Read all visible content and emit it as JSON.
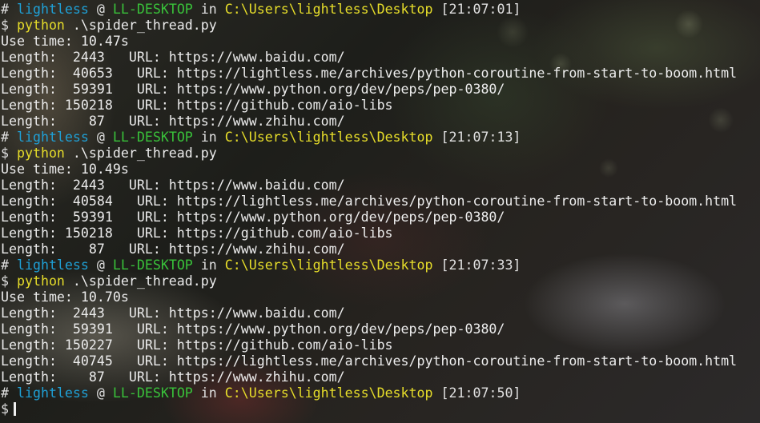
{
  "prompt_sep": " @ ",
  "prompt_in": " in ",
  "sessions": [
    {
      "user": "lightless",
      "host": "LL-DESKTOP",
      "path": "C:\\Users\\lightless\\Desktop",
      "time": "[21:07:01]",
      "command_bin": "python",
      "command_args": " .\\spider_thread.py",
      "use_time": "Use time: 10.47s",
      "results": [
        {
          "length": "Length:  2443",
          "url": "URL: https://www.baidu.com/"
        },
        {
          "length": "Length:  40653",
          "url": "URL: https://lightless.me/archives/python-coroutine-from-start-to-boom.html"
        },
        {
          "length": "Length:  59391",
          "url": "URL: https://www.python.org/dev/peps/pep-0380/"
        },
        {
          "length": "Length: 150218",
          "url": "URL: https://github.com/aio-libs"
        },
        {
          "length": "Length:    87",
          "url": "URL: https://www.zhihu.com/"
        }
      ]
    },
    {
      "user": "lightless",
      "host": "LL-DESKTOP",
      "path": "C:\\Users\\lightless\\Desktop",
      "time": "[21:07:13]",
      "command_bin": "python",
      "command_args": " .\\spider_thread.py",
      "use_time": "Use time: 10.49s",
      "results": [
        {
          "length": "Length:  2443",
          "url": "URL: https://www.baidu.com/"
        },
        {
          "length": "Length:  40584",
          "url": "URL: https://lightless.me/archives/python-coroutine-from-start-to-boom.html"
        },
        {
          "length": "Length:  59391",
          "url": "URL: https://www.python.org/dev/peps/pep-0380/"
        },
        {
          "length": "Length: 150218",
          "url": "URL: https://github.com/aio-libs"
        },
        {
          "length": "Length:    87",
          "url": "URL: https://www.zhihu.com/"
        }
      ]
    },
    {
      "user": "lightless",
      "host": "LL-DESKTOP",
      "path": "C:\\Users\\lightless\\Desktop",
      "time": "[21:07:33]",
      "command_bin": "python",
      "command_args": " .\\spider_thread.py",
      "use_time": "Use time: 10.70s",
      "results": [
        {
          "length": "Length:  2443",
          "url": "URL: https://www.baidu.com/"
        },
        {
          "length": "Length:  59391",
          "url": "URL: https://www.python.org/dev/peps/pep-0380/"
        },
        {
          "length": "Length: 150227",
          "url": "URL: https://github.com/aio-libs"
        },
        {
          "length": "Length:  40745",
          "url": "URL: https://lightless.me/archives/python-coroutine-from-start-to-boom.html"
        },
        {
          "length": "Length:    87",
          "url": "URL: https://www.zhihu.com/"
        }
      ]
    }
  ],
  "final_prompt": {
    "user": "lightless",
    "host": "LL-DESKTOP",
    "path": "C:\\Users\\lightless\\Desktop",
    "time": "[21:07:50]"
  },
  "colors": {
    "user": "#1fa0d6",
    "host": "#39c23a",
    "path": "#e6dd2a",
    "command": "#e6dd2a"
  }
}
